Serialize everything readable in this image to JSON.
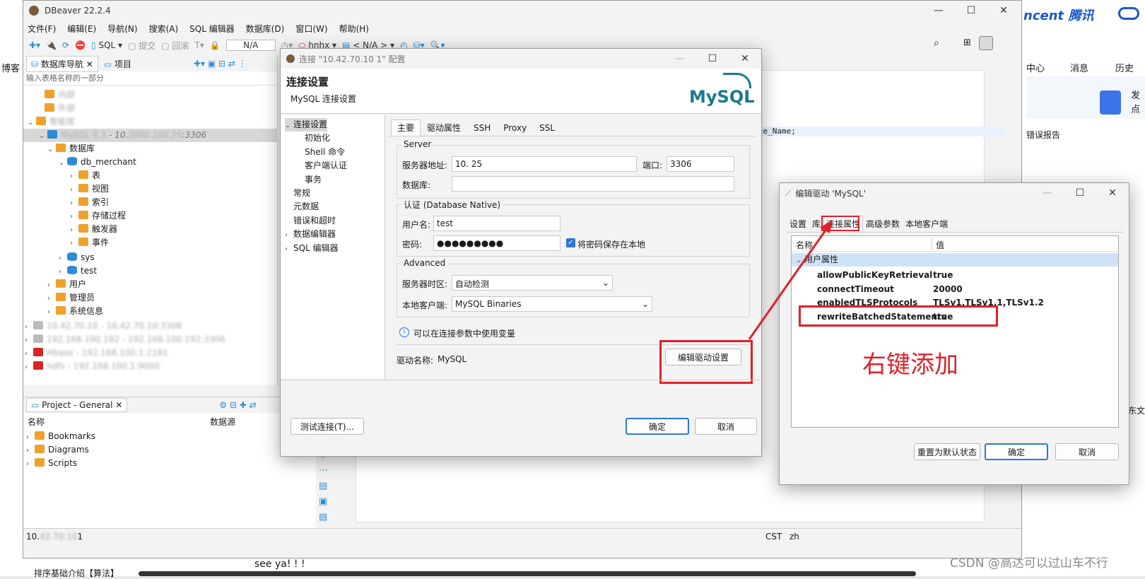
{
  "bg": {
    "left_text": "博客",
    "brand_right": "ncent 腾讯",
    "nav_center": "中心",
    "nav_messages": "消息",
    "nav_history": "历史",
    "side_text": "发点",
    "error_report": "错误报告",
    "side_b": "东文",
    "bottom_text": "see ya! ! !",
    "bottom_left": "排序基础介绍【算法】",
    "watermark": "CSDN @高达可以过山车不行"
  },
  "main": {
    "title": "DBeaver 22.2.4",
    "menu": [
      "文件(F)",
      "编辑(E)",
      "导航(N)",
      "搜索(A)",
      "SQL 编辑器",
      "数据库(D)",
      "窗口(W)",
      "帮助(H)"
    ],
    "toolbar": {
      "sql": "SQL",
      "commit": "提交",
      "rollback": "回滚",
      "na": "N/A",
      "schema": "hnhx",
      "na2": "< N/A >"
    },
    "nav_tab": "数据库导航",
    "project_tab": "项目",
    "filter_placeholder": "输入表格名称的一部分",
    "editor_text": "space_Name;",
    "status_cst": "CST",
    "status_zh": "zh",
    "status_left": "10.",
    "status_left_tail": "1"
  },
  "tree": {
    "blur1": "内部",
    "blur2": "外部",
    "blur3": "智能库",
    "conn_name": "MySQL 8.3",
    "conn_host": "- 10.",
    "conn_port": "3306",
    "databases": "数据库",
    "db_merchant": "db_merchant",
    "table": "表",
    "view": "视图",
    "index": "索引",
    "procedure": "存储过程",
    "trigger": "触发器",
    "event": "事件",
    "sys": "sys",
    "test": "test",
    "users": "用户",
    "admins": "管理员",
    "sysinfo": "系统信息",
    "conn2": "10.42.70.10 - 10.42.70.10:3306",
    "conn3": "192.168.100.192 - 192.168.100.192:3306",
    "conn4": "Hbase - 192.168.100.1:2181",
    "conn5": "hdfs - 192.168.100.1:9000"
  },
  "project": {
    "tab": "Project - General",
    "col_name": "名称",
    "col_ds": "数据源",
    "items": [
      "Bookmarks",
      "Diagrams",
      "Scripts"
    ]
  },
  "conn_dialog": {
    "title": "连接 \"10.42.70.10 1\" 配置",
    "heading": "连接设置",
    "subheading": "MySQL 连接设置",
    "logo": "MySQL",
    "nav": [
      "连接设置",
      "初始化",
      "Shell 命令",
      "客户端认证",
      "事务",
      "常规",
      "元数据",
      "错误和超时",
      "数据编辑器",
      "SQL 编辑器"
    ],
    "tabs": [
      "主要",
      "驱动属性",
      "SSH",
      "Proxy",
      "SSL"
    ],
    "server_group": "Server",
    "host_label": "服务器地址:",
    "host_value": "10.     25",
    "port_label": "端口:",
    "port_value": "3306",
    "db_label": "数据库:",
    "auth_group": "认证 (Database Native)",
    "user_label": "用户名:",
    "user_value": "test",
    "pwd_label": "密码:",
    "pwd_value": "●●●●●●●●●",
    "save_pwd": "将密码保存在本地",
    "adv_group": "Advanced",
    "tz_label": "服务器时区:",
    "tz_value": "自动检测",
    "client_label": "本地客户端:",
    "client_value": "MySQL Binaries",
    "info": "可以在连接参数中使用变量",
    "driver_label": "驱动名称:",
    "driver_value": "MySQL",
    "edit_driver_btn": "编辑驱动设置",
    "test_btn": "测试连接(T)...",
    "ok_btn": "确定",
    "cancel_btn": "取消"
  },
  "driver_dialog": {
    "title": "编辑驱动 'MySQL'",
    "tabs": [
      "设置",
      "库",
      "连接属性",
      "高级参数",
      "本地客户端"
    ],
    "col_name": "名称",
    "col_value": "值",
    "group": "用户属性",
    "props": [
      {
        "name": "allowPublicKeyRetrieval",
        "value": "true"
      },
      {
        "name": "connectTimeout",
        "value": "20000"
      },
      {
        "name": "enabledTLSProtocols",
        "value": "TLSv1,TLSv1.1,TLSv1.2"
      },
      {
        "name": "rewriteBatchedStatements",
        "value": "true"
      }
    ],
    "annotation": "右键添加",
    "reset_btn": "重置为默认状态",
    "ok_btn": "确定",
    "cancel_btn": "取消"
  },
  "colors": {
    "accent": "#2b79d7",
    "highlight": "#e0202a",
    "selection": "#cfe3f8"
  }
}
